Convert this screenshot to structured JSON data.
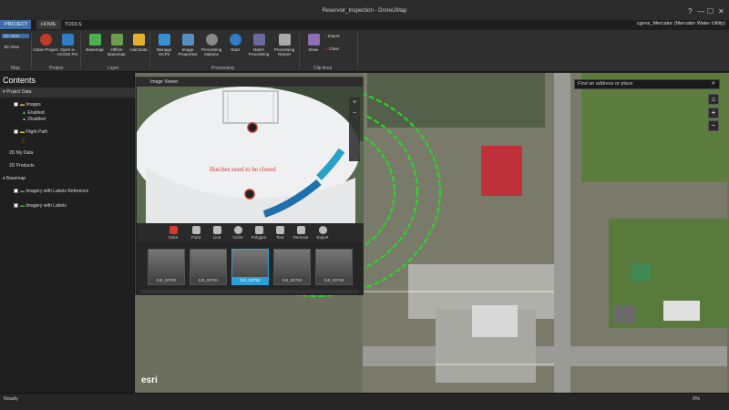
{
  "app": {
    "title": "Reservoir_Inspection - Drone2Map",
    "user": "cgens_Mercator (Mercator Water Utility)",
    "tabs": [
      "PROJECT",
      "HOME",
      "TOOLS"
    ],
    "window_controls": [
      "?",
      "—",
      "☐",
      "✕"
    ]
  },
  "ribbon": {
    "buttons": [
      {
        "id": "2d-view",
        "label": "2D View"
      },
      {
        "id": "3d-view",
        "label": "3D View"
      },
      {
        "id": "close-project",
        "label": "Close Project"
      },
      {
        "id": "open-arcgis-pro",
        "label": "Open in ArcGIS Pro"
      },
      {
        "id": "basemap",
        "label": "Basemap"
      },
      {
        "id": "offline-basemap",
        "label": "Offline Basemap"
      },
      {
        "id": "add-data",
        "label": "Add Data"
      },
      {
        "id": "manage-gcps",
        "label": "Manage GCPs"
      },
      {
        "id": "image-properties",
        "label": "Image Properties"
      },
      {
        "id": "processing-options",
        "label": "Processing Options"
      },
      {
        "id": "start",
        "label": "Start"
      },
      {
        "id": "batch-processing",
        "label": "Batch Processing"
      },
      {
        "id": "processing-report",
        "label": "Processing Report"
      },
      {
        "id": "draw",
        "label": "Draw"
      },
      {
        "id": "import",
        "label": "Import"
      },
      {
        "id": "clear",
        "label": "Clear"
      }
    ],
    "groups": [
      "Map",
      "Project",
      "Layer",
      "Processing",
      "Clip Area"
    ]
  },
  "sidebar": {
    "title": "Contents",
    "sections": [
      {
        "label": "Project Data"
      },
      {
        "label": "Images"
      },
      {
        "label": "Enabled"
      },
      {
        "label": "Disabled"
      },
      {
        "label": "Flight Path"
      },
      {
        "label": "2D My Data"
      },
      {
        "label": "2D Products"
      },
      {
        "label": "Basemap"
      },
      {
        "label": "Imagery with Labels Reference"
      },
      {
        "label": "Imagery with Labels"
      }
    ]
  },
  "viewer": {
    "title": "Image Viewer",
    "annotation": "Hatches need to be closed",
    "tools": [
      "Color",
      "Point",
      "Line",
      "Circle",
      "Polygon",
      "Text",
      "Remove",
      "Export"
    ],
    "thumbnails": [
      "DJI_00790",
      "DJI_00791",
      "DJI_00792",
      "DJI_00793",
      "DJI_00794"
    ],
    "active_thumbnail": 2
  },
  "map": {
    "search_placeholder": "Find an address or place",
    "logo": "esri"
  },
  "status": {
    "left": "Ready",
    "zoom": "0%"
  },
  "colors": {
    "accent": "#3c6ea8",
    "flight_path": "#22dd22",
    "annotation": "#d43a2e",
    "selected_thumb": "#2aa0d8"
  }
}
